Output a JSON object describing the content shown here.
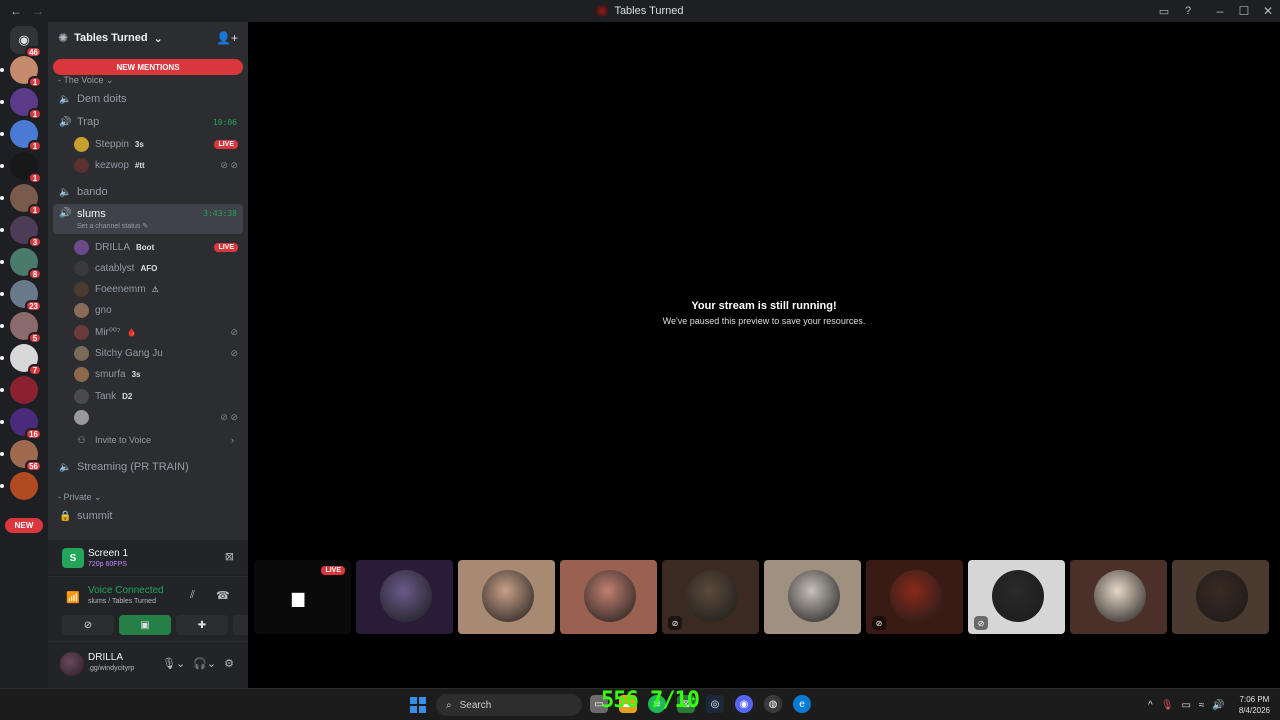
{
  "window": {
    "title": "Tables Turned",
    "back": "←",
    "forward": "→"
  },
  "rail": {
    "home_badge": "46",
    "new_label": "NEW",
    "servers": [
      {
        "badge": "1",
        "color": "#c58a6b"
      },
      {
        "badge": "1",
        "color": "#5b3a8a"
      },
      {
        "badge": "1",
        "color": "#4a7bd4"
      },
      {
        "badge": "1",
        "color": "#181818"
      },
      {
        "badge": "1",
        "color": "#7a5a4a"
      },
      {
        "badge": "3",
        "color": "#4c3c55"
      },
      {
        "badge": "8",
        "color": "#4a7a6a"
      },
      {
        "badge": "23",
        "color": "#6a7a8a"
      },
      {
        "badge": "5",
        "color": "#8a6a6a"
      },
      {
        "badge": "7",
        "color": "#d8d8d8"
      },
      {
        "badge": "",
        "color": "#8a2030"
      },
      {
        "badge": "16",
        "color": "#4a2a7a"
      },
      {
        "badge": "56",
        "color": "#a06a50"
      },
      {
        "badge": "",
        "color": "#b04a20"
      }
    ]
  },
  "sidebar": {
    "server_name": "Tables Turned",
    "new_mentions": "NEW MENTIONS",
    "category_voice": "- The Voice",
    "category_private": "- Private",
    "channels": {
      "dem_doits": "Dem doits",
      "trap": {
        "name": "Trap",
        "timer": "10:06"
      },
      "bando": "bando",
      "slums": {
        "name": "slums",
        "timer": "3:43:38",
        "status": "Set a channel status"
      },
      "streaming": "Streaming (PR TRAIN)",
      "summit": "summit"
    },
    "trap_users": [
      {
        "name": "Steppin",
        "tag": "3s",
        "live": "LIVE"
      },
      {
        "name": "kezwop",
        "tag": "#tt",
        "icons": "⊘ ⊘"
      }
    ],
    "slums_users": [
      {
        "name": "DRILLA",
        "tag": "Boot",
        "live": "LIVE"
      },
      {
        "name": "catablyst",
        "tag": "AFO"
      },
      {
        "name": "Foeenemm",
        "tag": "⚠"
      },
      {
        "name": "gno",
        "tag": ""
      },
      {
        "name": "Mir⁰⁰⁷",
        "tag": "🩸",
        "icons": "⊘"
      },
      {
        "name": "Sitchy Gang Ju",
        "tag": "",
        "icons": "⊘"
      },
      {
        "name": "smurfa",
        "tag": "3s"
      },
      {
        "name": "Tank",
        "tag": "D2"
      },
      {
        "name": "",
        "tag": "",
        "icons": "⊘ ⊘"
      }
    ],
    "invite": "Invite to Voice"
  },
  "screen_panel": {
    "title": "Screen 1",
    "quality": "720p 60FPS"
  },
  "voice_panel": {
    "status": "Voice Connected",
    "location": "slums / Tables Turned"
  },
  "user_panel": {
    "name": "DRILLA",
    "status": ".gg/windycityrp"
  },
  "stage": {
    "heading": "Your stream is still running!",
    "subtext": "We've paused this preview to save your resources.",
    "live_label": "LIVE"
  },
  "tiles": [
    {
      "kind": "stream",
      "bg": "#0a0a0a"
    },
    {
      "kind": "avatar",
      "bg": "#2a1c38",
      "circle": "#6a5a8a"
    },
    {
      "kind": "avatar",
      "bg": "#a88a72",
      "circle": "#c8a088"
    },
    {
      "kind": "avatar",
      "bg": "#9a6050",
      "circle": "#c08070"
    },
    {
      "kind": "avatar",
      "bg": "#3a2a22",
      "circle": "#5a4a3a",
      "muted": true
    },
    {
      "kind": "avatar",
      "bg": "#a09080",
      "circle": "#c8c0b8"
    },
    {
      "kind": "avatar",
      "bg": "#3a1a14",
      "circle": "#8a2a1a",
      "muted": true
    },
    {
      "kind": "avatar",
      "bg": "#d6d6d6",
      "circle": "#2a2a2a",
      "muted": true
    },
    {
      "kind": "avatar",
      "bg": "#4a3028",
      "circle": "#e8d8c8"
    },
    {
      "kind": "avatar",
      "bg": "#4a3a30",
      "circle": "#3a2a22"
    }
  ],
  "taskbar": {
    "search_placeholder": "Search",
    "overlay_text": "556 7/10",
    "time": "7:06 PM",
    "date": "8/4/2026"
  },
  "colors": {
    "accent_red": "#da373c",
    "connected_green": "#23a55a",
    "sidebar_bg": "#2b2d31",
    "rail_bg": "#1e1f22"
  }
}
